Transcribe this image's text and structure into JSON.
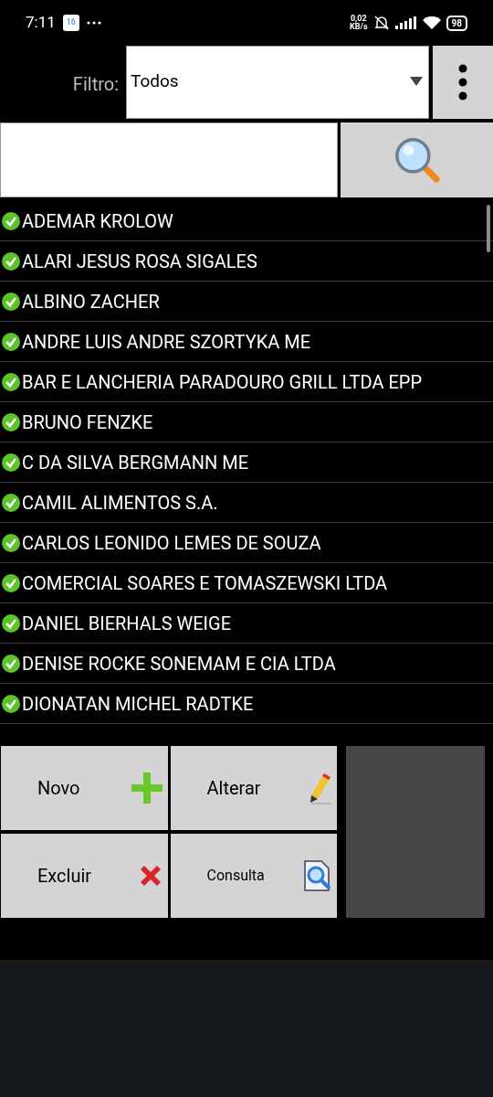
{
  "status_bar": {
    "time": "7:11",
    "calendar_badge": "16",
    "speed": [
      "0,02",
      "KB/s"
    ],
    "battery": "98"
  },
  "filter": {
    "label": "Filtro:",
    "value": "Todos"
  },
  "list": [
    {
      "name": "ADEMAR KROLOW",
      "active": true
    },
    {
      "name": "ALARI JESUS ROSA SIGALES",
      "active": true
    },
    {
      "name": "ALBINO ZACHER",
      "active": true
    },
    {
      "name": "ANDRE LUIS ANDRE SZORTYKA ME",
      "active": true
    },
    {
      "name": "BAR E LANCHERIA PARADOURO GRILL LTDA EPP",
      "active": true
    },
    {
      "name": "BRUNO FENZKE",
      "active": true
    },
    {
      "name": "C DA SILVA BERGMANN ME",
      "active": true
    },
    {
      "name": "CAMIL ALIMENTOS S.A.",
      "active": true
    },
    {
      "name": "CARLOS LEONIDO LEMES DE SOUZA",
      "active": true
    },
    {
      "name": "COMERCIAL SOARES E TOMASZEWSKI LTDA",
      "active": true
    },
    {
      "name": "DANIEL BIERHALS WEIGE",
      "active": true
    },
    {
      "name": "DENISE ROCKE SONEMAM E CIA LTDA",
      "active": true
    },
    {
      "name": "DIONATAN MICHEL RADTKE",
      "active": true
    }
  ],
  "buttons": [
    {
      "label": "Novo",
      "kind": "plus"
    },
    {
      "label": "Alterar",
      "kind": "pencil"
    },
    {
      "label": "Excluir",
      "kind": "delete"
    },
    {
      "label": "Consulta",
      "kind": "lookup"
    }
  ]
}
